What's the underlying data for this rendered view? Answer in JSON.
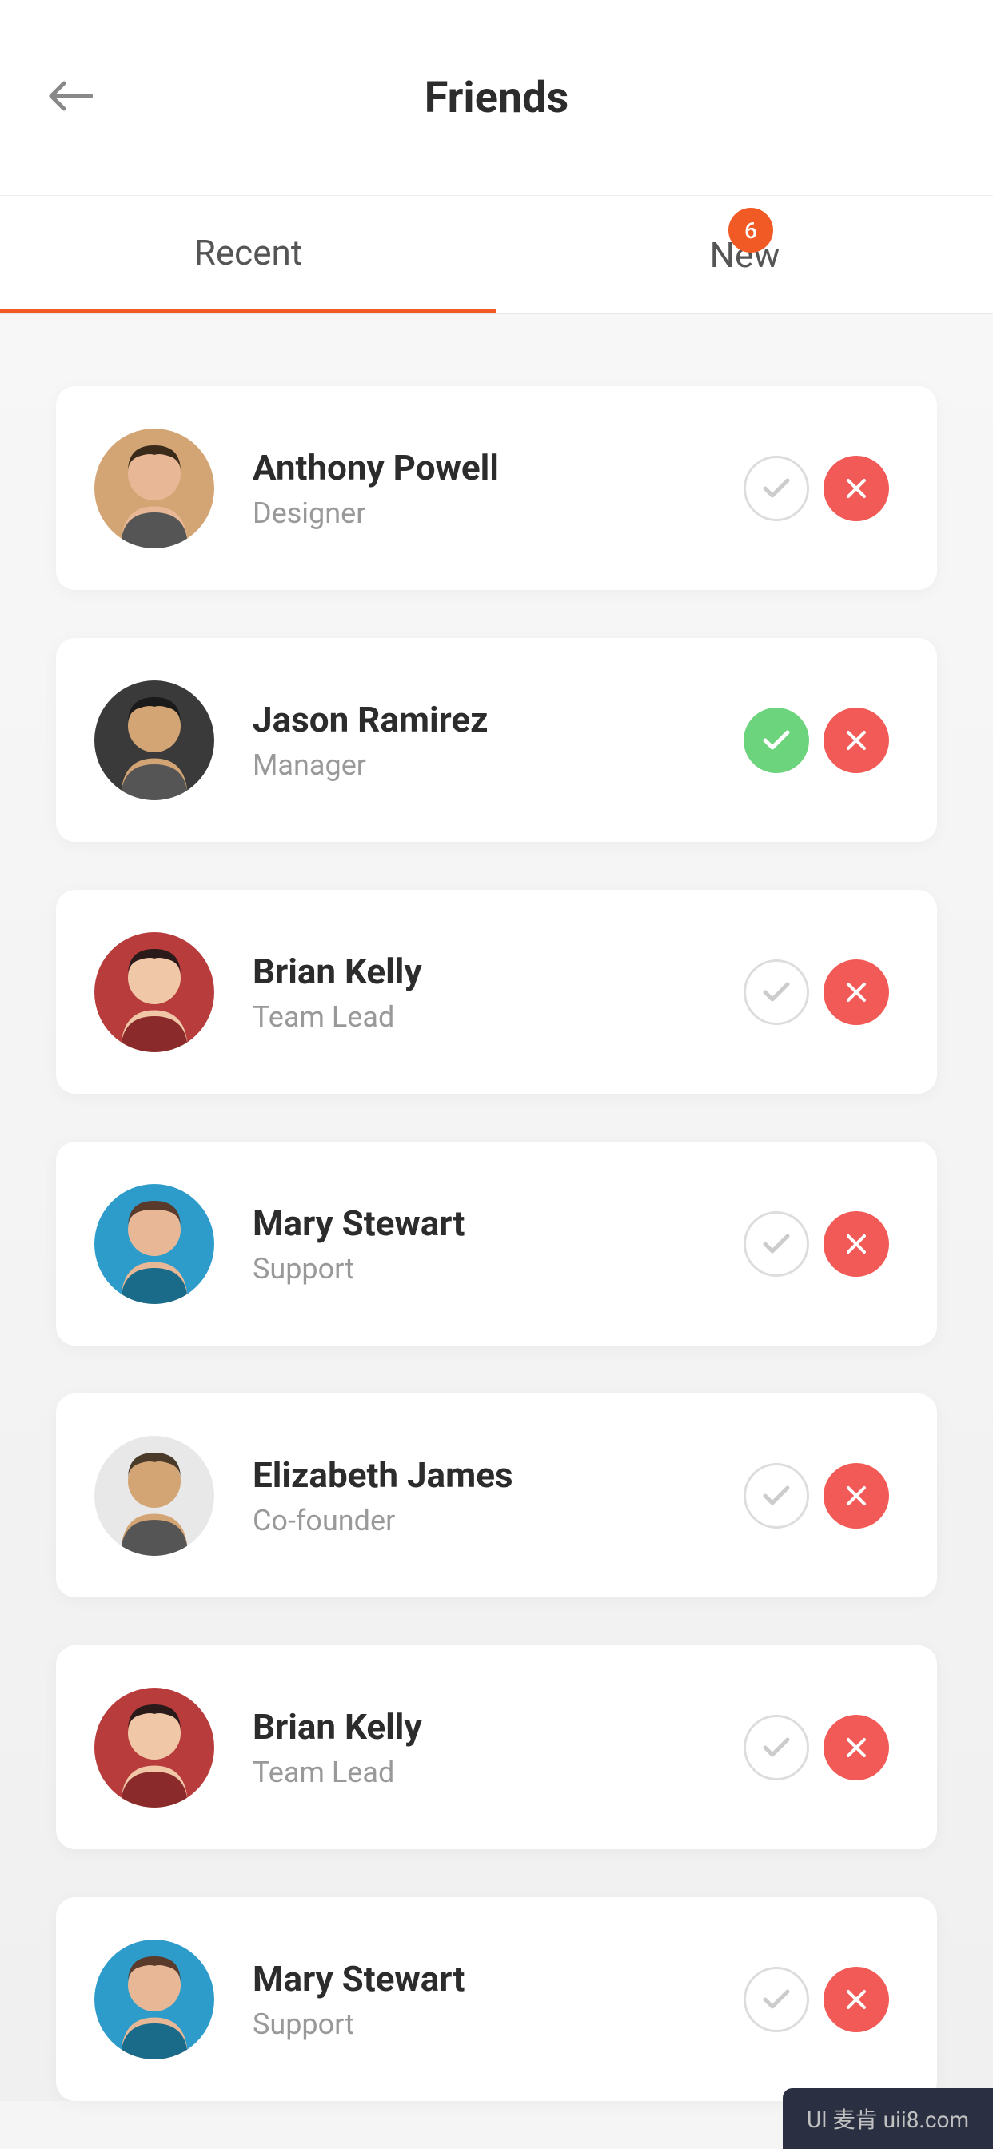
{
  "header": {
    "title": "Friends"
  },
  "tabs": {
    "recent": "Recent",
    "new": "New",
    "badge_count": "6"
  },
  "friends": [
    {
      "name": "Anthony Powell",
      "role": "Designer",
      "accepted": false,
      "avatar_bg": "#d4a574"
    },
    {
      "name": "Jason Ramirez",
      "role": "Manager",
      "accepted": true,
      "avatar_bg": "#3a3a3a"
    },
    {
      "name": "Brian Kelly",
      "role": "Team Lead",
      "accepted": false,
      "avatar_bg": "#b83c3c"
    },
    {
      "name": "Mary Stewart",
      "role": "Support",
      "accepted": false,
      "avatar_bg": "#2e9cca"
    },
    {
      "name": "Elizabeth James",
      "role": "Co-founder",
      "accepted": false,
      "avatar_bg": "#e8e8e8"
    },
    {
      "name": "Brian Kelly",
      "role": "Team Lead",
      "accepted": false,
      "avatar_bg": "#b83c3c"
    },
    {
      "name": "Mary Stewart",
      "role": "Support",
      "accepted": false,
      "avatar_bg": "#2e9cca"
    }
  ],
  "watermark": "UI 麦肯 uii8.com"
}
